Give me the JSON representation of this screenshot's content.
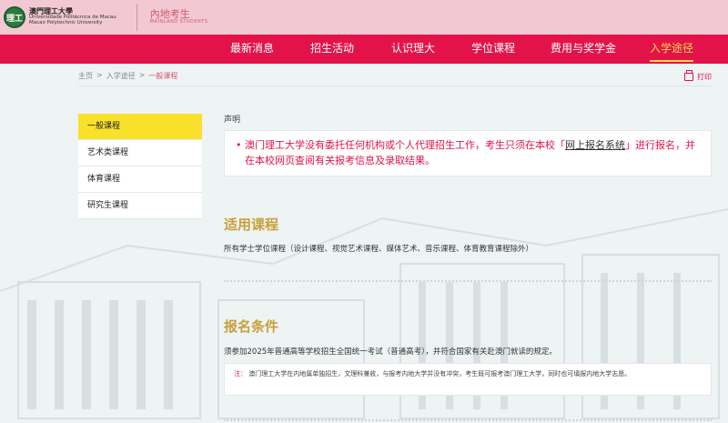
{
  "header": {
    "logo_mark": "理工",
    "logo_cn": "澳門理工大學",
    "logo_pt1": "Universidade Politécnica de Macau",
    "logo_pt2": "Macao Polytechnic University",
    "section_cn": "內地考生",
    "section_en": "MAINLAND STUDENTS"
  },
  "nav": {
    "items": [
      "最新消息",
      "招生活动",
      "认识理大",
      "学位课程",
      "费用与奖学金",
      "入学途径"
    ],
    "active_index": 5
  },
  "breadcrumb": [
    "主页",
    ">",
    "入学途径",
    ">",
    "一般课程"
  ],
  "print_label": "打印",
  "sidebar": {
    "items": [
      "一般课程",
      "艺术类课程",
      "体育课程",
      "研究生课程"
    ],
    "active_index": 0
  },
  "statement": {
    "label": "声明",
    "text_before": "澳门理工大学没有委托任何机构或个人代理招生工作，考生只须在本校「",
    "link": "网上报名系统",
    "text_after": "」进行报名，并在本校网页查阅有关报考信息及录取结果。"
  },
  "sections": [
    {
      "heading": "适用课程",
      "text": "所有学士学位课程（设计课程、视觉艺术课程、媒体艺术、音乐课程、体育教育课程除外）"
    },
    {
      "heading": "报名条件",
      "text": "须参加2025年普通高等学校招生全国统一考试（普通高考），并符合国家有关赴澳门就读的规定。",
      "note_label": "注：",
      "note_text": "澳门理工大学在内地属单独招生，文理科兼收，与报考内地大学并没有冲突，考生既可报考澳门理工大学，同时也可填报内地大学志愿。"
    }
  ],
  "colors": {
    "nav_bg": "#e3134a",
    "header_bg": "#f2c9d3",
    "active_nav": "#f7d94c",
    "sidebar_active": "#f9e02b",
    "heading": "#c8a03a"
  }
}
